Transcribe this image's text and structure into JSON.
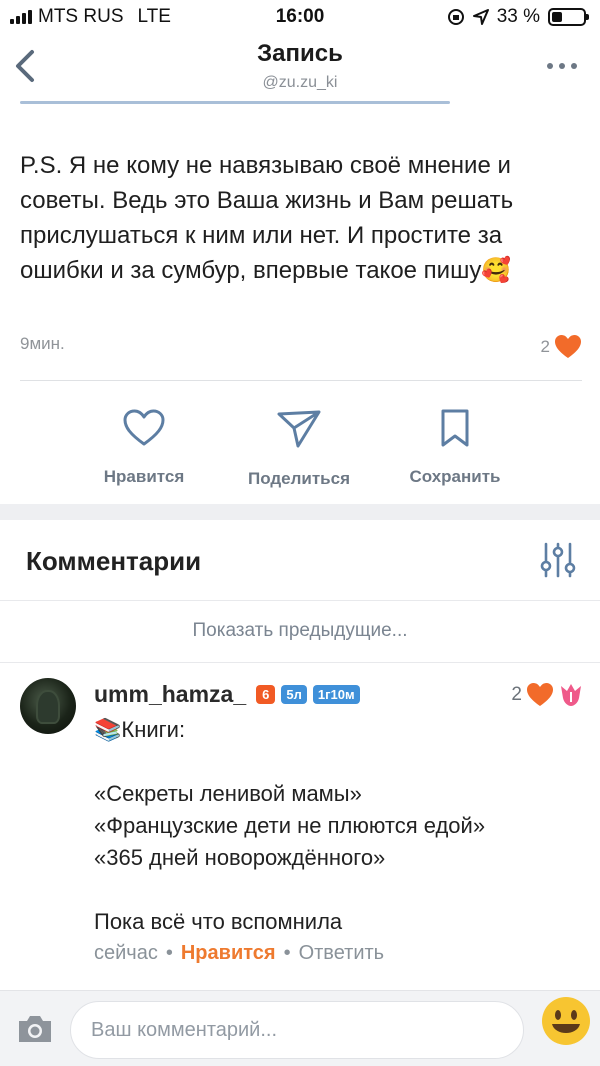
{
  "status_bar": {
    "carrier": "MTS RUS",
    "network": "LTE",
    "time": "16:00",
    "battery_text": "33 %",
    "battery_level_percent": 33
  },
  "nav": {
    "title": "Запись",
    "subtitle": "@zu.zu_ki"
  },
  "post": {
    "text": "P.S. Я не кому не навязываю своё мнение и советы. Ведь это Ваша жизнь и Вам решать прислушаться к ним или нет. И простите за ошибки и за сумбур, впервые такое пишу🥰",
    "time": "9мин.",
    "likes": "2"
  },
  "actions": {
    "like_label": "Нравится",
    "share_label": "Поделиться",
    "save_label": "Сохранить"
  },
  "comments": {
    "header": "Комментарии",
    "show_previous": "Показать предыдущие...",
    "items": [
      {
        "author": "umm_hamza_",
        "badges": [
          "6",
          "5л",
          "1г10м"
        ],
        "likes": "2",
        "lines": [
          "📚Книги:",
          "",
          "«Секреты ленивой мамы»",
          "«Французские дети не плюются едой»",
          "«365 дней новорождённого»",
          "",
          "Пока всё что вспомнила"
        ],
        "time": "сейчас",
        "like_action": "Нравится",
        "reply_action": "Ответить"
      }
    ]
  },
  "input": {
    "placeholder": "Ваш комментарий..."
  },
  "colors": {
    "accent_orange": "#f15a24",
    "heart": "#f26b2a",
    "badge_blue": "#3f90d9",
    "muted": "#6d7885"
  },
  "icons": [
    "back-icon",
    "more-icon",
    "heart-icon",
    "share-icon",
    "bookmark-icon",
    "filter-icon",
    "tulip-icon",
    "camera-icon",
    "smile-icon"
  ]
}
